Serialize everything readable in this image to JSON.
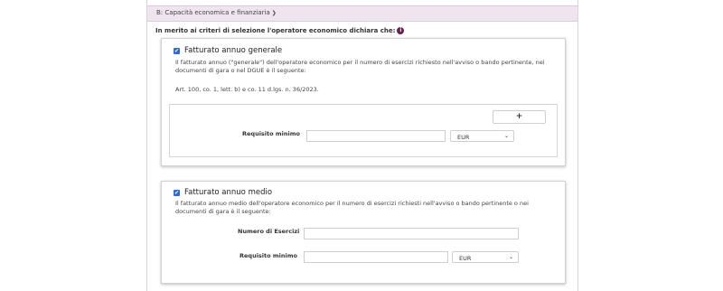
{
  "section": {
    "title": "B: Capacità economica e finanziaria",
    "chevron": "❯"
  },
  "intro": {
    "text": "In merito ai criteri di selezione l'operatore economico dichiara che:",
    "icon": "i"
  },
  "card1": {
    "checked": true,
    "title": "Fatturato annuo generale",
    "description": "Il fatturato annuo (\"generale\") dell'operatore economico per il numero di esercizi richiesto nell'avviso o bando pertinente, nei documenti di gara o nel DGUE è il seguente:",
    "law": "Art. 100, co. 1, lett. b) e co. 11 d.lgs. n. 36/2023.",
    "add_button": "+",
    "requisito_label": "Requisito minimo",
    "requisito_value": "",
    "currency": "EUR"
  },
  "card2": {
    "checked": true,
    "title": "Fatturato annuo medio",
    "description": "Il fatturato annuo medio dell'operatore economico per il numero di esercizi richiesti nell'avviso o bando pertinente o nei documenti di gara è il seguente:",
    "esercizi_label": "Numero di Esercizi",
    "esercizi_value": "",
    "requisito_label": "Requisito minimo",
    "requisito_value": "",
    "currency": "EUR"
  }
}
